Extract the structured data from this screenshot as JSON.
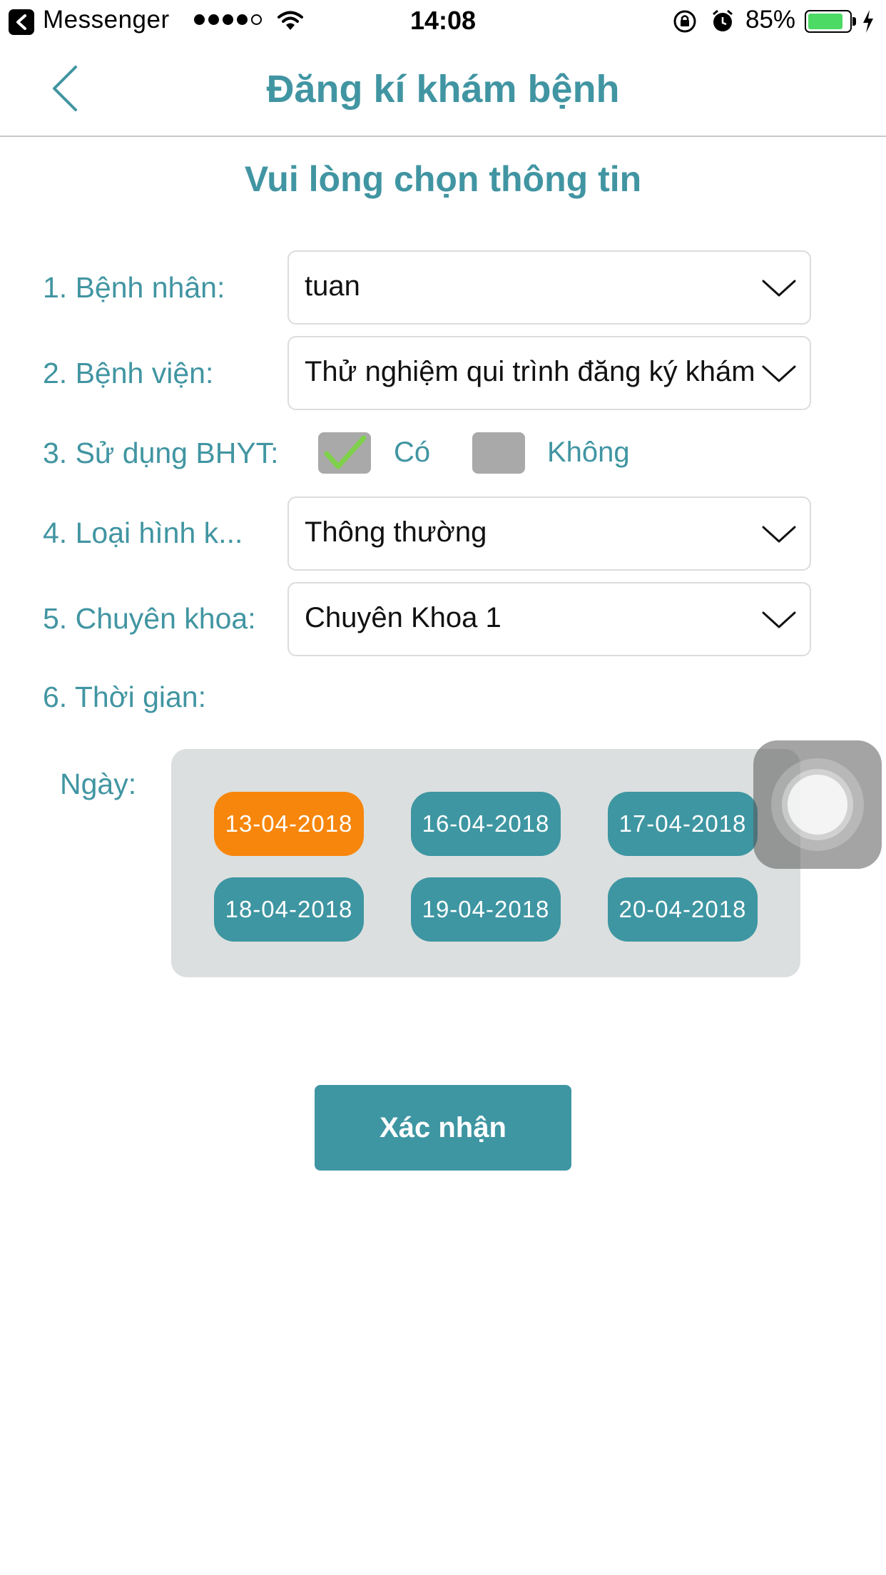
{
  "status_bar": {
    "app_name": "Messenger",
    "time": "14:08",
    "battery_percent": "85%",
    "battery_level": 0.85,
    "signal_dots": 5,
    "signal_filled": 4
  },
  "header": {
    "title": "Đăng kí khám bệnh"
  },
  "form": {
    "subtitle": "Vui lòng chọn thông tin",
    "patient": {
      "label": "1. Bệnh nhân:",
      "value": "tuan"
    },
    "hospital": {
      "label": "2. Bệnh viện:",
      "value": "Thử nghiệm qui trình đăng ký khám"
    },
    "insurance": {
      "label": "3. Sử dụng BHYT:",
      "yes_label": "Có",
      "no_label": "Không",
      "selected": "Có"
    },
    "exam_type": {
      "label": "4. Loại hình k...",
      "value": "Thông thường"
    },
    "specialty": {
      "label": "5. Chuyên khoa:",
      "value": "Chuyên Khoa 1"
    },
    "time": {
      "label": "6. Thời gian:"
    },
    "date": {
      "label": "Ngày:",
      "options": [
        "13-04-2018",
        "16-04-2018",
        "17-04-2018",
        "18-04-2018",
        "19-04-2018",
        "20-04-2018"
      ],
      "selected": "13-04-2018"
    },
    "confirm_label": "Xác nhận"
  },
  "colors": {
    "accent": "#4195a2",
    "date_button": "#3e96a2",
    "selected_date": "#f7860c",
    "panel": "#dcdfdf",
    "checkbox": "#a9a9a9",
    "check_mark": "#7fd14a",
    "battery": "#4cd964"
  }
}
